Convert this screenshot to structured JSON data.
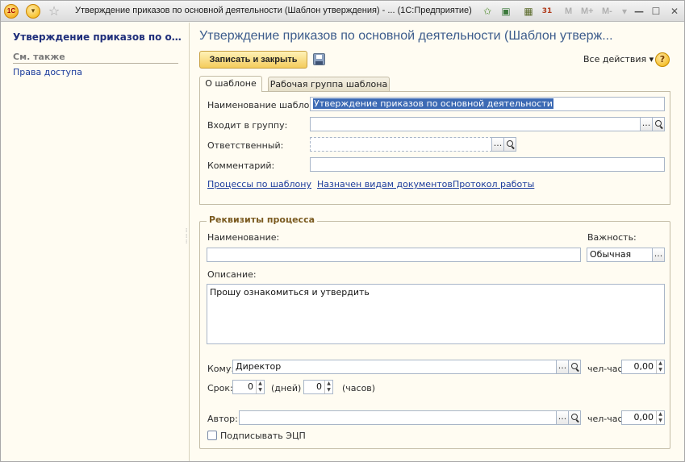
{
  "window": {
    "logo_text": "1С",
    "title": "Утверждение приказов по основной деятельности (Шаблон утверждения) - ...  (1С:Предприятие)",
    "toolbar_glyphs": {
      "favorites": "☆",
      "star_add": "✩",
      "calc": "▦",
      "calendar": "31"
    },
    "mem_buttons": [
      "M",
      "M+",
      "M-"
    ],
    "controls": {
      "minimize": "—",
      "maximize": "☐",
      "close": "✕"
    }
  },
  "sidebar": {
    "title": "Утверждение приказов по основ...",
    "see_also": "См. также",
    "links": [
      "Права доступа"
    ]
  },
  "header": {
    "title": "Утверждение приказов по основной деятельности (Шаблон утверж...",
    "save_close": "Записать и закрыть",
    "all_actions": "Все действия ▾",
    "help": "?"
  },
  "tabs": [
    {
      "label": "О шаблоне",
      "active": true
    },
    {
      "label": "Рабочая группа шаблона",
      "active": false
    }
  ],
  "form": {
    "name_label": "Наименование шаблона:",
    "name_value": "Утверждение приказов по основной деятельности",
    "group_label": "Входит в группу:",
    "group_value": "",
    "responsible_label": "Ответственный:",
    "responsible_value": "",
    "comment_label": "Комментарий:",
    "comment_value": "",
    "links": [
      "Процессы по шаблону",
      "Назначен видам документов",
      "Протокол работы"
    ]
  },
  "process": {
    "group_title": "Реквизиты процесса",
    "name_label": "Наименование:",
    "name_value": "",
    "importance_label": "Важность:",
    "importance_value": "Обычная",
    "desc_label": "Описание:",
    "desc_value": "Прошу ознакомиться и утвердить",
    "to_label": "Кому:",
    "to_value": "Директор",
    "manhours_label": "чел-час:",
    "manhours_value": "0,00",
    "deadline_label": "Срок:",
    "days_value": "0",
    "days_label": "(дней)",
    "hours_value": "0",
    "hours_label": "(часов)",
    "author_label": "Автор:",
    "author_value": "",
    "author_manhours_label": "чел-час:",
    "author_manhours_value": "0,00",
    "sign_label": "Подписывать ЭЦП"
  },
  "glyphs": {
    "ellipsis": "...",
    "spin_up": "▲",
    "spin_down": "▼"
  }
}
